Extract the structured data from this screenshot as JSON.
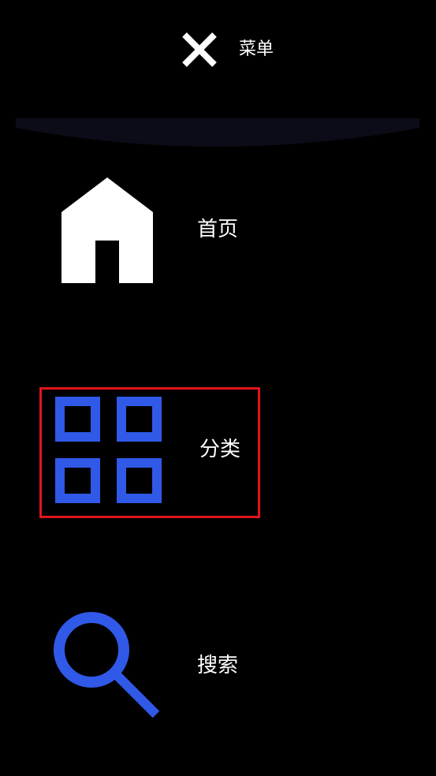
{
  "header": {
    "close_icon": "close-icon",
    "menu_label": "菜单"
  },
  "menu": {
    "items": [
      {
        "label": "首页",
        "icon": "home-icon",
        "icon_color": "#ffffff",
        "selected": false
      },
      {
        "label": "分类",
        "icon": "grid-icon",
        "icon_color": "#3059e8",
        "selected": true
      },
      {
        "label": "搜索",
        "icon": "search-icon",
        "icon_color": "#3059e8",
        "selected": false
      }
    ]
  },
  "colors": {
    "background": "#000000",
    "accent": "#3059e8",
    "selection_border": "#e0151c",
    "header_curve": "#0c0c18"
  }
}
